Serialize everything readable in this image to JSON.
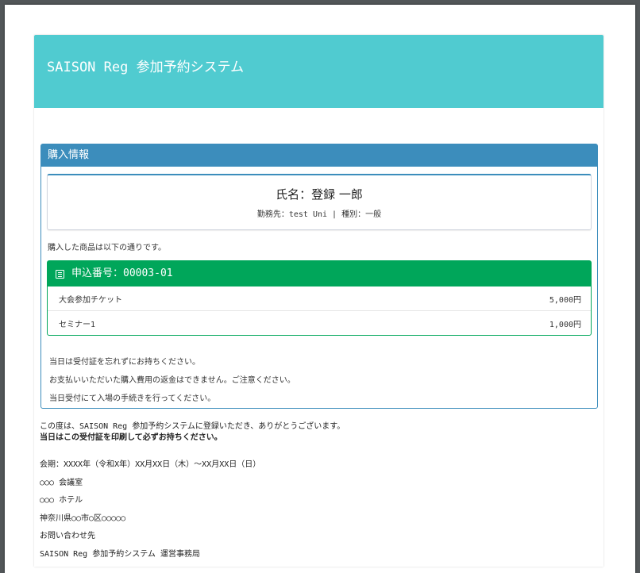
{
  "header": {
    "title": "SAISON Reg 参加予約システム"
  },
  "purchase_panel": {
    "title": "購入情報",
    "name_line": "氏名：登録 一郎",
    "affiliation_line": "勤務先：test Uni | 種別：一般",
    "intro": "購入した商品は以下の通りです。",
    "order": {
      "title": "申込番号：00003-01",
      "items": [
        {
          "label": "大会参加チケット",
          "price": "5,000円"
        },
        {
          "label": "セミナー1",
          "price": "1,000円"
        }
      ]
    },
    "notes": [
      "当日は受付証を忘れずにお持ちください。",
      "お支払いいただいた購入費用の返金はできません。ご注意ください。",
      "当日受付にて入場の手続きを行ってください。"
    ]
  },
  "footer": {
    "thanks": "この度は、SAISON Reg 参加予約システムに登録いただき、ありがとうございます。",
    "bring_notice": "当日はこの受付証を印刷して必ずお持ちください。",
    "info_lines": [
      "会期：XXXX年（令和X年）XX月XX日（木）～XX月XX日（日）",
      "○○○ 会議室",
      "○○○ ホテル",
      "神奈川県○○市○区○○○○○",
      "お問い合わせ先",
      "SAISON Reg 参加予約システム 運営事務局"
    ]
  },
  "colors": {
    "header_bg": "#50cbd0",
    "panel_primary": "#3c8dbc",
    "order_success": "#00a65a"
  },
  "icons": {
    "order_icon": "list-icon"
  }
}
